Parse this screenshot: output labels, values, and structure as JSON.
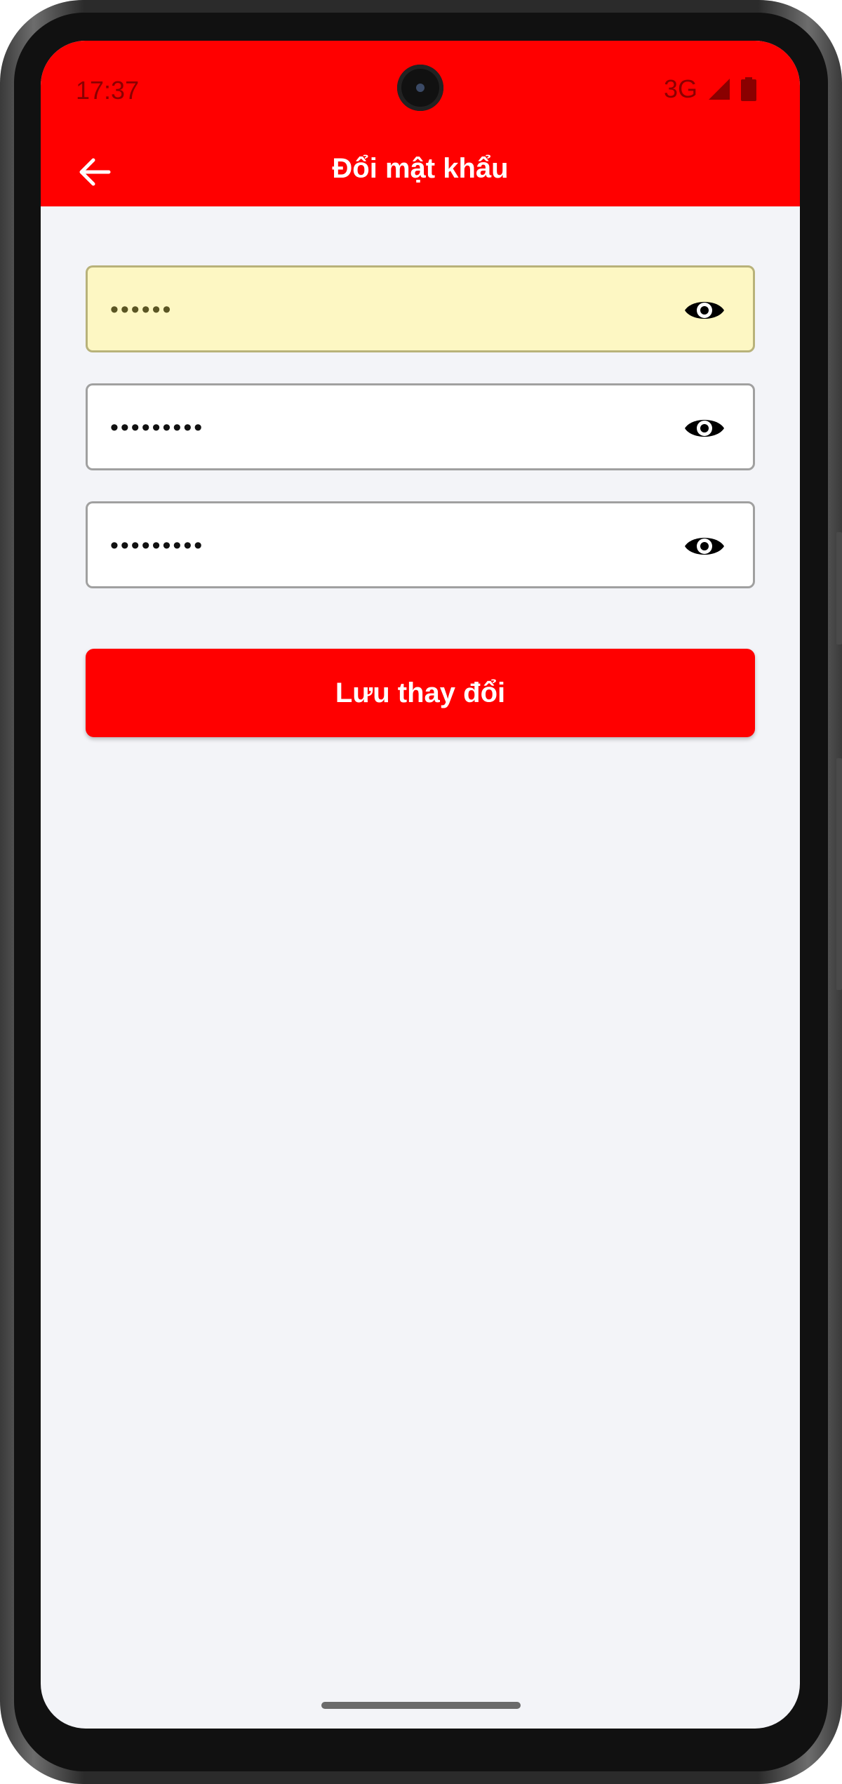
{
  "status_bar": {
    "time": "17:37",
    "network": "3G",
    "icons": [
      "signal-icon",
      "battery-icon"
    ]
  },
  "header": {
    "title": "Đổi mật khẩu",
    "back_icon": "arrow-left-icon"
  },
  "form": {
    "fields": [
      {
        "name": "current-password",
        "value": "••••••",
        "autofilled": true,
        "icon": "eye-icon"
      },
      {
        "name": "new-password",
        "value": "•••••••••",
        "autofilled": false,
        "icon": "eye-icon"
      },
      {
        "name": "confirm-password",
        "value": "•••••••••",
        "autofilled": false,
        "icon": "eye-icon"
      }
    ],
    "save_label": "Lưu thay đổi"
  },
  "colors": {
    "brand": "#ff0000",
    "background": "#f3f4f8",
    "autofill": "#fdf7c3"
  }
}
